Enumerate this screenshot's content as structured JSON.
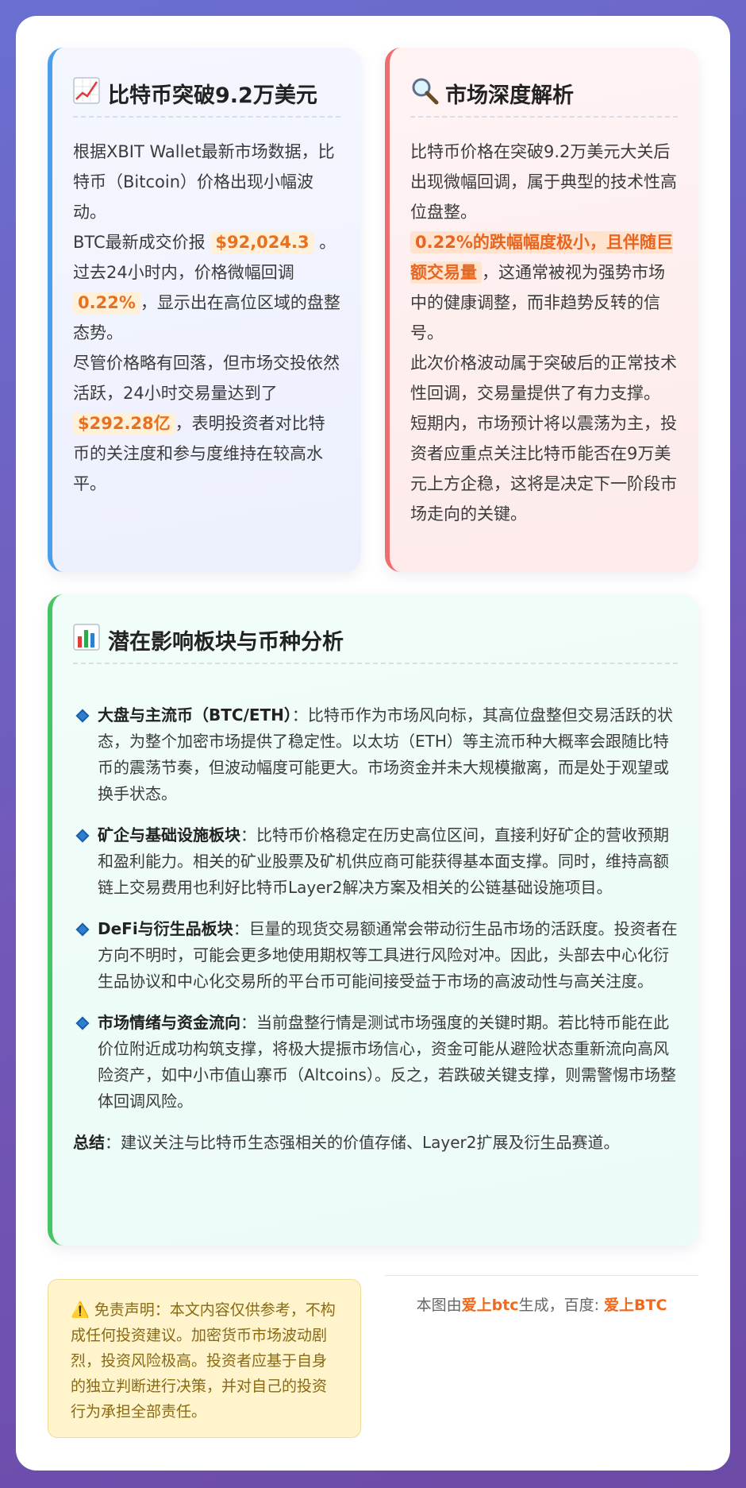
{
  "left_card": {
    "icon": "chart-increasing-icon",
    "title": "比特币突破9.2万美元",
    "p1": "根据XBIT Wallet最新市场数据，比特币（Bitcoin）价格出现小幅波动。",
    "p2_pre": "BTC最新成交价报",
    "price": "$92,024.3",
    "p2_post": "。",
    "p3_pre": "过去24小时内，价格微幅回调",
    "change": "0.22%",
    "p3_post": "，显示出在高位区域的盘整态势。",
    "p4_pre": "尽管价格略有回落，但市场交投依然活跃，24小时交易量达到了",
    "volume": "$292.28亿",
    "p4_post": "，表明投资者对比特币的关注度和参与度维持在较高水平。"
  },
  "right_card": {
    "icon": "magnifier-icon",
    "title": "市场深度解析",
    "p1": "比特币价格在突破9.2万美元大关后出现微幅回调，属于典型的技术性高位盘整。",
    "p2_hl": "0.22%的跌幅幅度极小，且伴随巨额交易量",
    "p2_post": "，这通常被视为强势市场中的健康调整，而非趋势反转的信号。",
    "p3": "此次价格波动属于突破后的正常技术性回调，交易量提供了有力支撑。",
    "p4": "短期内，市场预计将以震荡为主，投资者应重点关注比特币能否在9万美元上方企稳，这将是决定下一阶段市场走向的关键。"
  },
  "wide_card": {
    "icon": "bar-chart-icon",
    "title": "潜在影响板块与币种分析",
    "items": [
      {
        "label": "大盘与主流币（BTC/ETH）",
        "text": "：比特币作为市场风向标，其高位盘整但交易活跃的状态，为整个加密市场提供了稳定性。以太坊（ETH）等主流币种大概率会跟随比特币的震荡节奏，但波动幅度可能更大。市场资金并未大规模撤离，而是处于观望或换手状态。"
      },
      {
        "label": "矿企与基础设施板块",
        "text": "：比特币价格稳定在历史高位区间，直接利好矿企的营收预期和盈利能力。相关的矿业股票及矿机供应商可能获得基本面支撑。同时，维持高额链上交易费用也利好比特币Layer2解决方案及相关的公链基础设施项目。"
      },
      {
        "label": "DeFi与衍生品板块",
        "text": "：巨量的现货交易额通常会带动衍生品市场的活跃度。投资者在方向不明时，可能会更多地使用期权等工具进行风险对冲。因此，头部去中心化衍生品协议和中心化交易所的平台币可能间接受益于市场的高波动性与高关注度。"
      },
      {
        "label": "市场情绪与资金流向",
        "text": "：当前盘整行情是测试市场强度的关键时期。若比特币能在此价位附近成功构筑支撑，将极大提振市场信心，资金可能从避险状态重新流向高风险资产，如中小市值山寨币（Altcoins）。反之，若跌破关键支撑，则需警惕市场整体回调风险。"
      }
    ],
    "summary_label": "总结",
    "summary_text": "：建议关注与比特币生态强相关的价值存储、Layer2扩展及衍生品赛道。"
  },
  "disclaimer": {
    "icon": "warning-icon",
    "text": "免责声明：本文内容仅供参考，不构成任何投资建议。加密货币市场波动剧烈，投资风险极高。投资者应基于自身的独立判断进行决策，并对自己的投资行为承担全部责任。"
  },
  "footer": {
    "pre": "本图由",
    "brand1": "爱上btc",
    "mid": "生成，百度: ",
    "brand2": "爱上BTC"
  },
  "colors": {
    "accent_orange": "#e8711f",
    "left_border": "#4a9fea",
    "right_border": "#ee6e6e",
    "wide_border": "#45c563"
  }
}
